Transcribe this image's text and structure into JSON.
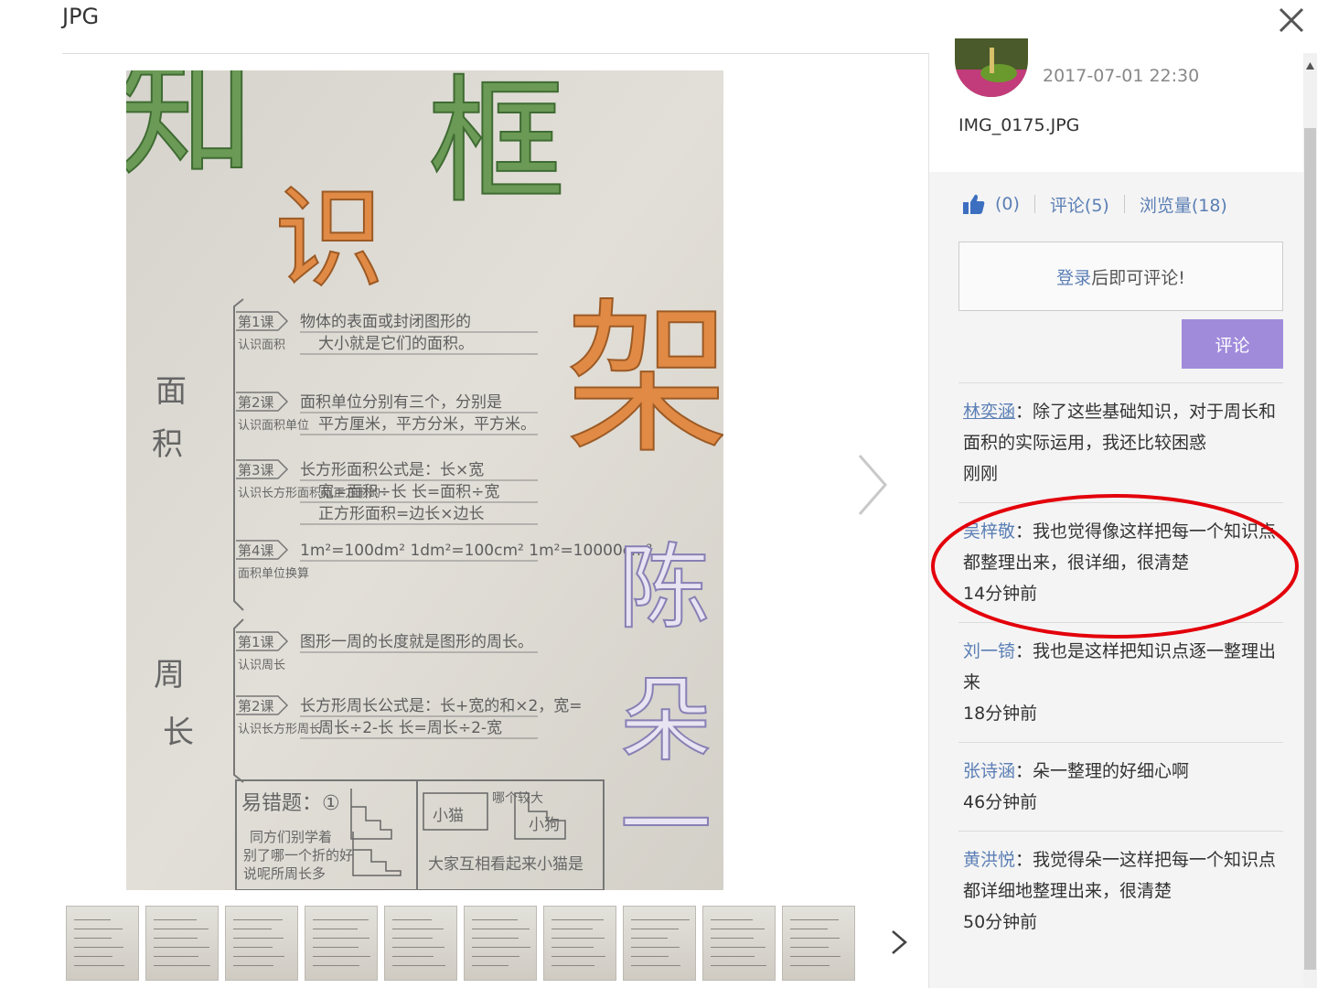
{
  "viewer": {
    "title": "JPG",
    "close_glyph": "✕"
  },
  "photo": {
    "title_chars": [
      "知",
      "识",
      "框",
      "架"
    ],
    "author_chars": [
      "陈",
      "朵",
      "一"
    ],
    "section_labels": [
      [
        "面",
        "积"
      ],
      [
        "周",
        "长"
      ]
    ],
    "lessons": [
      {
        "tag": "第1课",
        "sub": "认识面积",
        "lines": [
          "物体的表面或封闭图形的",
          "大小就是它们的面积。"
        ]
      },
      {
        "tag": "第2课",
        "sub": "认识面积单位",
        "lines": [
          "面积单位分别有三个，分别是",
          "平方厘米，平方分米，平方米。"
        ]
      },
      {
        "tag": "第3课",
        "sub": "认识长方形面积和正方形的",
        "lines": [
          "长方形面积公式是：长×宽",
          "宽=面积÷长  长=面积÷宽",
          "正方形面积=边长×边长"
        ]
      },
      {
        "tag": "第4课",
        "sub": "面积单位换算",
        "lines": [
          "1m²=100dm²   1dm²=100cm²   1m²=10000cm²"
        ]
      },
      {
        "tag": "第1课",
        "sub": "认识周长",
        "lines": [
          "图形一周的长度就是图形的周长。"
        ]
      },
      {
        "tag": "第2课",
        "sub": "认识长方形周长",
        "lines": [
          "长方形周长公式是：长+宽的和×2，宽=",
          "周长÷2-长  长=周长÷2-宽"
        ]
      }
    ],
    "bottom_box": {
      "title": "易错题：①",
      "left_lines": [
        "同方们别学着",
        "别了哪一个折的好",
        "说呢所周长多"
      ],
      "right_words": [
        "小猫",
        "哪个较大",
        "小狗"
      ],
      "right_line": "大家互相看起来小猫是"
    }
  },
  "thumbnails_count": 10,
  "panel": {
    "post_time": "2017-07-01 22:30",
    "file_name": "IMG_0175.JPG",
    "likes": "(0)",
    "comments_stat": "评论(5)",
    "views_stat": "浏览量(18)",
    "login_link": "登录",
    "login_suffix": "后即可评论!",
    "comment_button": "评论"
  },
  "comments": [
    {
      "author": "林奕涵",
      "sep": "：",
      "text": "除了这些基础知识，对于周长和面积的实际运用，我还比较困惑",
      "time": "刚刚"
    },
    {
      "author": "吴梓敬",
      "sep": "：",
      "text": "我也觉得像这样把每一个知识点都整理出来，很详细，很清楚",
      "time": "14分钟前"
    },
    {
      "author": "刘一锜",
      "sep": "：",
      "text": "我也是这样把知识点逐一整理出来",
      "time": "18分钟前"
    },
    {
      "author": "张诗涵",
      "sep": "：",
      "text": "朵一整理的好细心啊",
      "time": "46分钟前"
    },
    {
      "author": "黄洪悦",
      "sep": "：",
      "text": "我觉得朵一这样把每一个知识点都详细地整理出来，很清楚",
      "time": "50分钟前"
    }
  ],
  "colors": {
    "link": "#5b7fb5",
    "button": "#a08bdb",
    "highlight": "#e3000b",
    "title_green": "#5c8a47",
    "title_orange": "#d9823e",
    "author_purple": "#8880b4"
  }
}
